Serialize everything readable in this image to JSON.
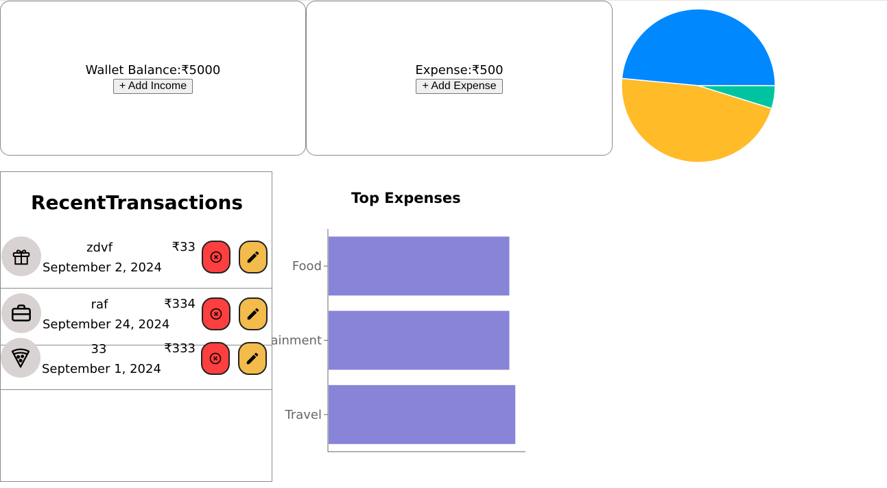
{
  "wallet": {
    "label": "Wallet Balance:",
    "amount": "₹5000",
    "button": "+ Add Income"
  },
  "expense": {
    "label": "Expense:",
    "amount": "₹500",
    "button": "+ Add Expense"
  },
  "pie_chart": {
    "type": "pie",
    "slices": [
      {
        "name": "slice-blue",
        "value": 48.5,
        "color": "#0088fe"
      },
      {
        "name": "slice-yellow",
        "value": 46.7,
        "color": "#ffbb28"
      },
      {
        "name": "slice-green",
        "value": 4.8,
        "color": "#00c49f"
      }
    ]
  },
  "recent": {
    "title": "RecentTransactions",
    "transactions": [
      {
        "name": "zdvf",
        "amount": "₹33",
        "date": "September 2, 2024",
        "icon": "gift-icon"
      },
      {
        "name": "raf",
        "amount": "₹334",
        "date": "September 24, 2024",
        "icon": "briefcase-icon"
      },
      {
        "name": "33",
        "amount": "₹333",
        "date": "September 1, 2024",
        "icon": "pizza-icon"
      }
    ]
  },
  "chart_data": {
    "type": "bar",
    "orientation": "horizontal",
    "title": "Top Expenses",
    "categories": [
      "Food",
      "Entertainment",
      "Travel"
    ],
    "visible_tick_labels": [
      "Food",
      "ainment",
      "Travel"
    ],
    "values": [
      333,
      333,
      344
    ],
    "xlim": [
      0,
      364
    ],
    "bar_color": "#8884d8",
    "grid": false,
    "legend": "none"
  },
  "colors": {
    "delete_button": "#fe3f3f",
    "edit_button": "#f3bb4b",
    "icon_bg": "#d9d2d2"
  }
}
